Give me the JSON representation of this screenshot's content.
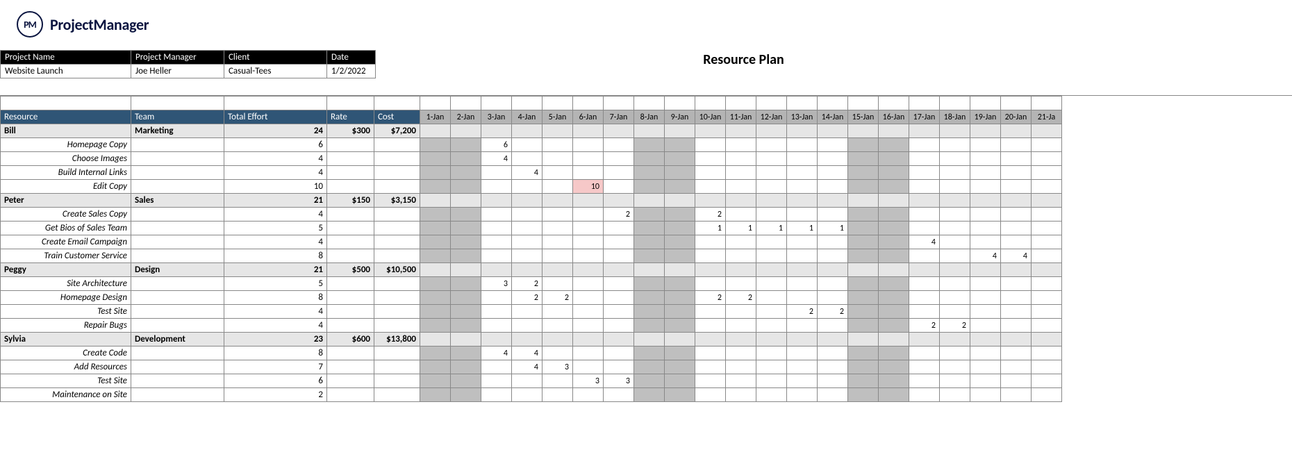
{
  "brand": {
    "badge": "PM",
    "name": "ProjectManager"
  },
  "title": "Resource Plan",
  "meta": {
    "headers": {
      "project_name": "Project Name",
      "project_manager": "Project Manager",
      "client": "Client",
      "date": "Date"
    },
    "values": {
      "project_name": "Website Launch",
      "project_manager": "Joe Heller",
      "client": "Casual-Tees",
      "date": "1/2/2022"
    }
  },
  "columns": {
    "resource": "Resource",
    "team": "Team",
    "effort": "Total Effort",
    "rate": "Rate",
    "cost": "Cost"
  },
  "days": [
    "1-Jan",
    "2-Jan",
    "3-Jan",
    "4-Jan",
    "5-Jan",
    "6-Jan",
    "7-Jan",
    "8-Jan",
    "9-Jan",
    "10-Jan",
    "11-Jan",
    "12-Jan",
    "13-Jan",
    "14-Jan",
    "15-Jan",
    "16-Jan",
    "17-Jan",
    "18-Jan",
    "19-Jan",
    "20-Jan",
    "21-Ja"
  ],
  "weekend_idx": [
    0,
    1,
    7,
    8,
    14,
    15
  ],
  "marker_day_idx": 9,
  "chart_data": {
    "type": "table",
    "title": "Resource Plan",
    "groups": [
      {
        "name": "Bill",
        "team": "Marketing",
        "effort": 24,
        "rate": "$300",
        "cost": "$7,200",
        "tasks": [
          {
            "name": "Homepage Copy",
            "effort": 6,
            "days": {
              "3-Jan": 6
            }
          },
          {
            "name": "Choose Images",
            "effort": 4,
            "days": {
              "3-Jan": 4
            }
          },
          {
            "name": "Build Internal Links",
            "effort": 4,
            "days": {
              "4-Jan": 4
            }
          },
          {
            "name": "Edit Copy",
            "effort": 10,
            "days": {
              "6-Jan": 10
            },
            "over": [
              "6-Jan"
            ]
          }
        ]
      },
      {
        "name": "Peter",
        "team": "Sales",
        "effort": 21,
        "rate": "$150",
        "cost": "$3,150",
        "tasks": [
          {
            "name": "Create Sales Copy",
            "effort": 4,
            "days": {
              "7-Jan": 2,
              "10-Jan": 2
            }
          },
          {
            "name": "Get Bios of Sales Team",
            "effort": 5,
            "days": {
              "10-Jan": 1,
              "11-Jan": 1,
              "12-Jan": 1,
              "13-Jan": 1,
              "14-Jan": 1
            }
          },
          {
            "name": "Create Email Campaign",
            "effort": 4,
            "days": {
              "17-Jan": 4
            }
          },
          {
            "name": "Train Customer Service",
            "effort": 8,
            "days": {
              "19-Jan": 4,
              "20-Jan": 4
            }
          }
        ]
      },
      {
        "name": "Peggy",
        "team": "Design",
        "effort": 21,
        "rate": "$500",
        "cost": "$10,500",
        "tasks": [
          {
            "name": "Site Architecture",
            "effort": 5,
            "days": {
              "3-Jan": 3,
              "4-Jan": 2
            }
          },
          {
            "name": "Homepage Design",
            "effort": 8,
            "days": {
              "4-Jan": 2,
              "5-Jan": 2,
              "10-Jan": 2,
              "11-Jan": 2
            }
          },
          {
            "name": "Test Site",
            "effort": 4,
            "days": {
              "13-Jan": 2,
              "14-Jan": 2
            }
          },
          {
            "name": "Repair Bugs",
            "effort": 4,
            "days": {
              "17-Jan": 2,
              "18-Jan": 2
            }
          }
        ]
      },
      {
        "name": "Sylvia",
        "team": "Development",
        "effort": 23,
        "rate": "$600",
        "cost": "$13,800",
        "tasks": [
          {
            "name": "Create Code",
            "effort": 8,
            "days": {
              "3-Jan": 4,
              "4-Jan": 4
            }
          },
          {
            "name": "Add Resources",
            "effort": 7,
            "days": {
              "4-Jan": 4,
              "5-Jan": 3
            }
          },
          {
            "name": "Test Site",
            "effort": 6,
            "days": {
              "6-Jan": 3,
              "7-Jan": 3
            }
          },
          {
            "name": "Maintenance on Site",
            "effort": 2,
            "days": {}
          }
        ]
      }
    ]
  }
}
